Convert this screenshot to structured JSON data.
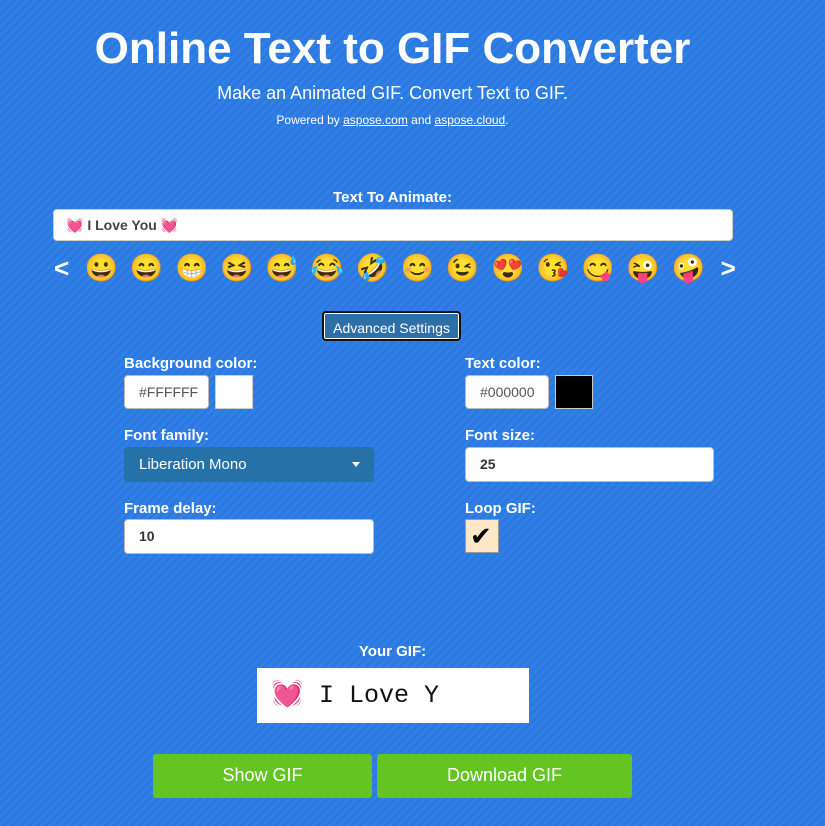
{
  "header": {
    "title": "Online Text to GIF Converter",
    "subtitle": "Make an Animated GIF. Convert Text to GIF.",
    "powered_prefix": "Powered by ",
    "link1": "aspose.com",
    "powered_mid": " and ",
    "link2": "aspose.cloud",
    "powered_suffix": "."
  },
  "text_input": {
    "label": "Text To Animate:",
    "value": "💓 I Love You 💓"
  },
  "emoji_picker": {
    "prev": "<",
    "next": ">",
    "emojis": [
      "😀",
      "😄",
      "😁",
      "😆",
      "😅",
      "😂",
      "🤣",
      "😊",
      "😉",
      "😍",
      "😘",
      "😋",
      "😜",
      "🤪"
    ]
  },
  "advanced_button": "Advanced Settings",
  "settings": {
    "background_color": {
      "label": "Background color:",
      "value": "#FFFFFF",
      "swatch": "#FFFFFF"
    },
    "text_color": {
      "label": "Text color:",
      "value": "#000000",
      "swatch": "#000000"
    },
    "font_family": {
      "label": "Font family:",
      "selected": "Liberation Mono"
    },
    "font_size": {
      "label": "Font size:",
      "value": "25"
    },
    "frame_delay": {
      "label": "Frame delay:",
      "value": "10"
    },
    "loop_gif": {
      "label": "Loop GIF:",
      "checked": true,
      "check_glyph": "✔"
    }
  },
  "result": {
    "label": "Your GIF:",
    "preview_emoji": "💓",
    "preview_text": "I Love Y"
  },
  "buttons": {
    "show": "Show GIF",
    "download": "Download GIF"
  }
}
